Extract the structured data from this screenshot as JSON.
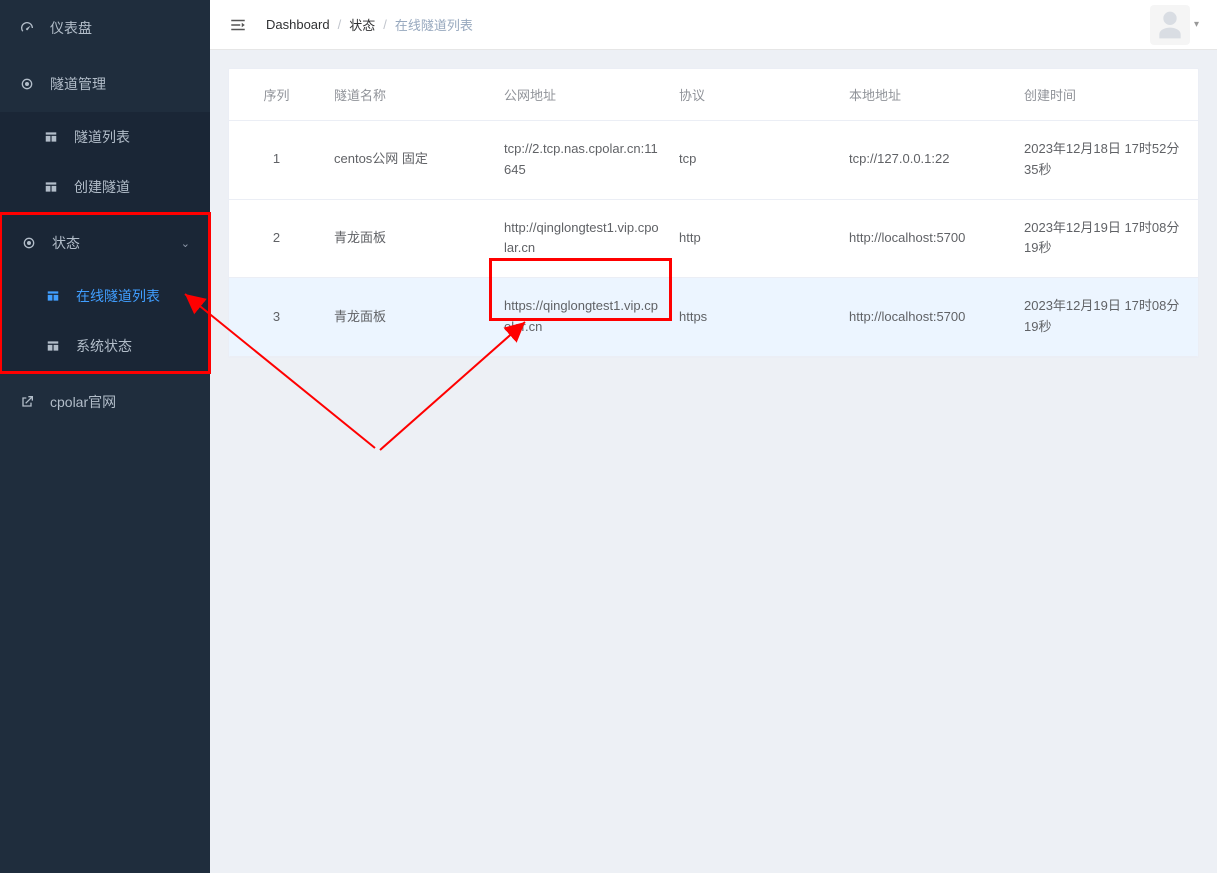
{
  "sidebar": {
    "dashboard": "仪表盘",
    "tunnel_mgmt": "隧道管理",
    "tunnel_list": "隧道列表",
    "create_tunnel": "创建隧道",
    "status": "状态",
    "online_tunnels": "在线隧道列表",
    "system_status": "系统状态",
    "official_site": "cpolar官网"
  },
  "breadcrumbs": {
    "root": "Dashboard",
    "section": "状态",
    "page": "在线隧道列表"
  },
  "table": {
    "headers": {
      "index": "序列",
      "name": "隧道名称",
      "public_addr": "公网地址",
      "protocol": "协议",
      "local_addr": "本地地址",
      "created": "创建时间"
    },
    "rows": [
      {
        "index": "1",
        "name": "centos公网 固定",
        "public_addr": "tcp://2.tcp.nas.cpolar.cn:11645",
        "protocol": "tcp",
        "local_addr": "tcp://127.0.0.1:22",
        "created": "2023年12月18日 17时52分35秒"
      },
      {
        "index": "2",
        "name": "青龙面板",
        "public_addr": "http://qinglongtest1.vip.cpolar.cn",
        "protocol": "http",
        "local_addr": "http://localhost:5700",
        "created": "2023年12月19日 17时08分19秒"
      },
      {
        "index": "3",
        "name": "青龙面板",
        "public_addr": "https://qinglongtest1.vip.cpolar.cn",
        "protocol": "https",
        "local_addr": "http://localhost:5700",
        "created": "2023年12月19日 17时08分19秒"
      }
    ]
  }
}
